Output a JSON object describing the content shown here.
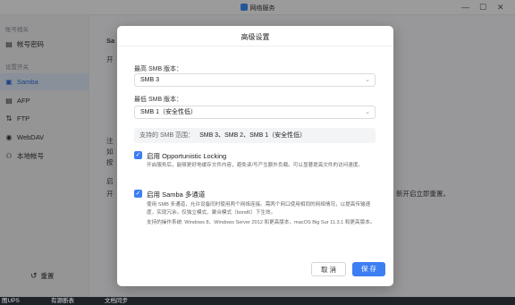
{
  "window": {
    "title": "网络服务",
    "controls": [
      "—",
      "☐",
      "✕"
    ]
  },
  "sidebar": {
    "section1": "账号相关",
    "account_item": "帐号密码",
    "section2": "设置开关",
    "items": [
      {
        "label": "Samba",
        "icon": "samba-icon"
      },
      {
        "label": "AFP",
        "icon": "afp-icon"
      },
      {
        "label": "FTP",
        "icon": "ftp-icon"
      },
      {
        "label": "WebDAV",
        "icon": "webdav-icon"
      },
      {
        "label": "本地帐号",
        "icon": "local-account-icon"
      }
    ],
    "reset": "重置"
  },
  "background": {
    "fragments": [
      "Sa",
      "开",
      "注",
      "如",
      "按",
      "启",
      "开",
      "新开启立即重置。"
    ]
  },
  "dialog": {
    "title": "高级设置",
    "max_label": "最高 SMB 版本：",
    "max_value": "SMB 3",
    "min_label": "最低 SMB 版本：",
    "min_value": "SMB 1（安全性低）",
    "range_label": "支持的 SMB 范围：",
    "range_value": "SMB 3、SMB 2、SMB 1（安全性低）",
    "oplock_label": "启用 Opportunistic Locking",
    "oplock_checked": true,
    "oplock_desc": "开启服务后，能够更好地缓存文件内容，避免读/写产生额外负载。可以显著提高文件的访问速度。",
    "multichannel_label": "启用 Samba 多通道",
    "multichannel_checked": true,
    "multichannel_desc1": "使用 SMB 多通道，允许设备同时使用两个网络连接。需两个网口使用相同的网络情况，以提高传输速度，实现冗余。仅独立模式、聚合模式（bond6）下生效。",
    "multichannel_desc2": "支持的操作系统: Windows 8、Windows Server 2012 和更高版本，macOS Big Sur 11.3.1 和更高版本。",
    "cancel": "取 消",
    "save": "保 存"
  },
  "taskbar": {
    "items": [
      "图UPS",
      "有源断表",
      "文档同步"
    ]
  }
}
